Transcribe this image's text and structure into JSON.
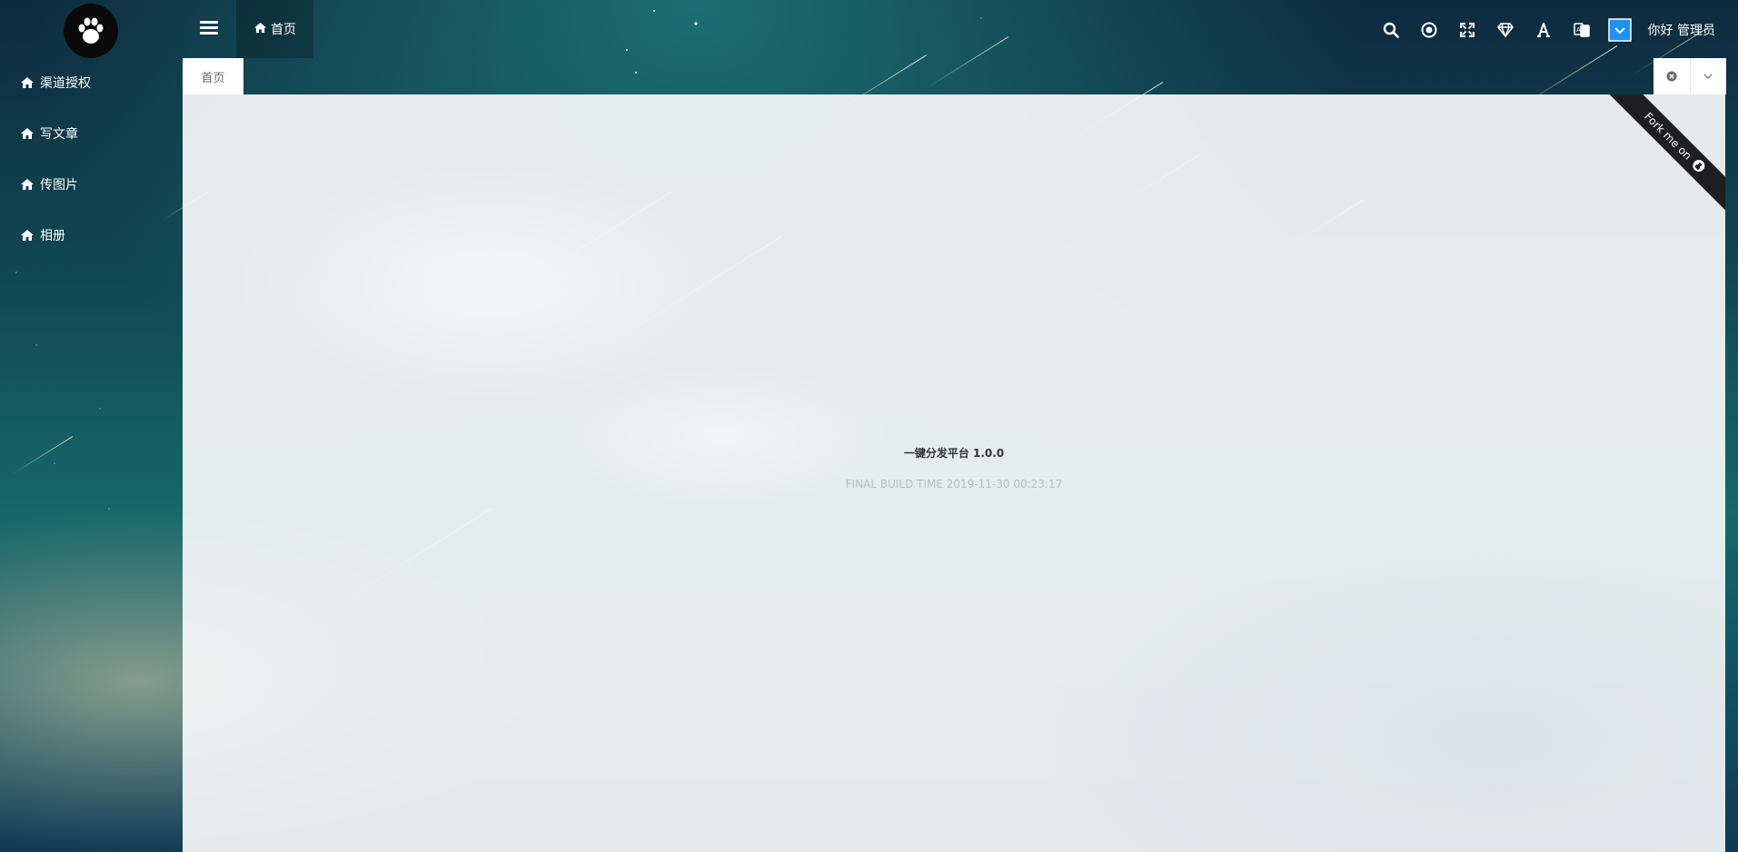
{
  "sidebar": {
    "logo_icon": "paw-icon",
    "items": [
      {
        "label": "渠道授权",
        "icon": "home-icon"
      },
      {
        "label": "写文章",
        "icon": "home-icon"
      },
      {
        "label": "传图片",
        "icon": "home-icon"
      },
      {
        "label": "相册",
        "icon": "home-icon"
      }
    ]
  },
  "topbar": {
    "menu_icon": "hamburger-icon",
    "home_tab_label": "首页",
    "tools": [
      "search-icon",
      "target-icon",
      "fullscreen-icon",
      "diamond-icon",
      "font-icon",
      "translate-icon",
      "theme-toggle-icon"
    ],
    "greeting": "你好 管理员"
  },
  "tabs": {
    "items": [
      {
        "label": "首页"
      }
    ],
    "close_icon": "close-circle-icon",
    "dropdown_icon": "chevron-down-icon"
  },
  "main": {
    "app_name": "一键分发平台 1.0.0",
    "build_time": "FINAL BUILD TIME 2019-11-30 00:23:17"
  },
  "ribbon": {
    "text": "Fork me on",
    "icon": "github-icon"
  },
  "colors": {
    "sidebar_text": "#ffffff",
    "ribbon_bg": "#1f1f23",
    "theme_toggle": "#1e90ff"
  }
}
